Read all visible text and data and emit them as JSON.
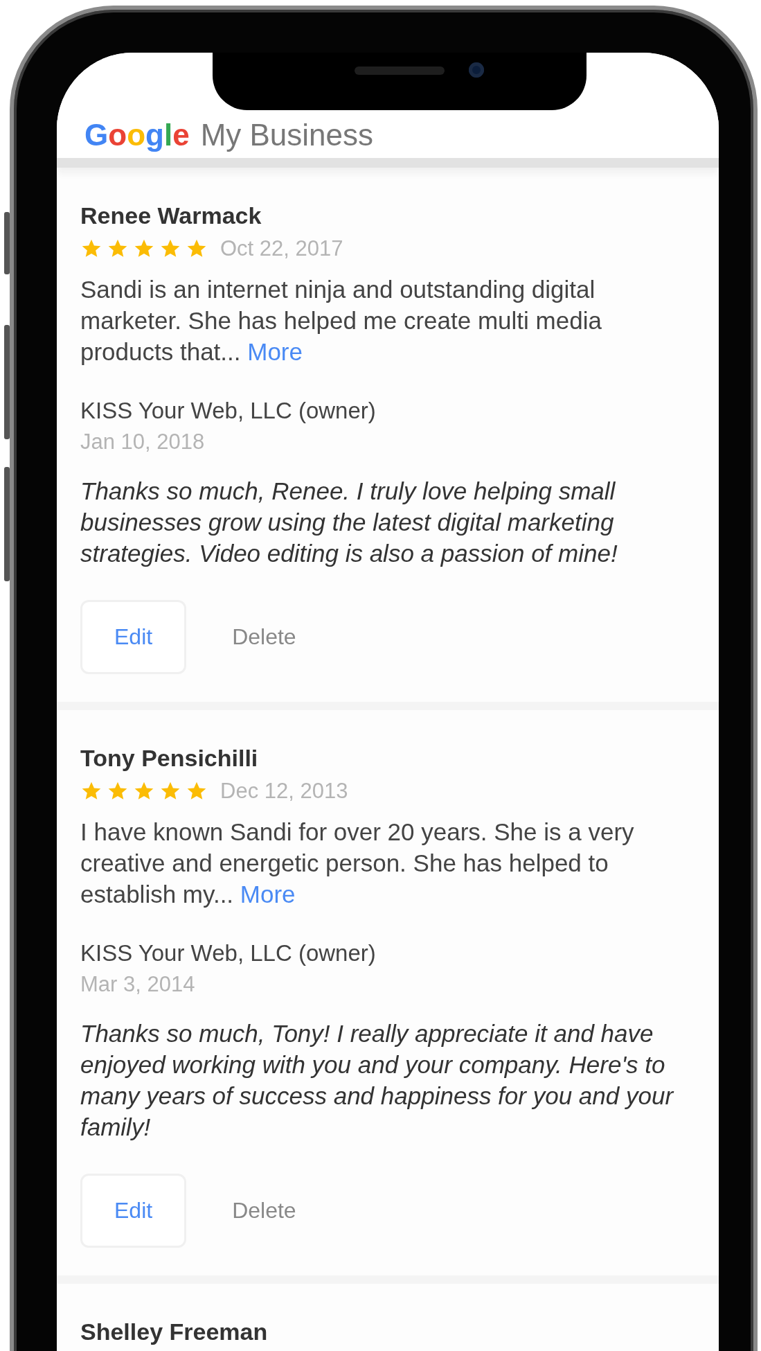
{
  "header": {
    "logo": "Google",
    "title": "My Business"
  },
  "reviews": [
    {
      "name": "Renee Warmack",
      "stars": 5,
      "date": "Oct 22, 2017",
      "text": "Sandi is an internet ninja and outstanding digital marketer. She has helped me create multi media products that...",
      "more": "More",
      "reply": {
        "owner": "KISS Your Web, LLC (owner)",
        "date": "Jan 10, 2018",
        "text": "Thanks so much, Renee. I truly love helping small businesses grow using the latest digital marketing strategies. Video editing is also a passion of mine!"
      },
      "actions": [
        "Edit",
        "Delete"
      ]
    },
    {
      "name": "Tony Pensichilli",
      "stars": 5,
      "date": "Dec 12, 2013",
      "text": "I have known Sandi for over 20 years. She is a very creative and energetic person. She has helped to establish my...",
      "more": "More",
      "reply": {
        "owner": "KISS Your Web, LLC (owner)",
        "date": "Mar 3, 2014",
        "text": "Thanks so much, Tony! I really appreciate it and have enjoyed working with you and your company. Here's to many years of success and happiness for you and your family!"
      },
      "actions": [
        "Edit",
        "Delete"
      ]
    },
    {
      "name": "Shelley Freeman"
    }
  ]
}
